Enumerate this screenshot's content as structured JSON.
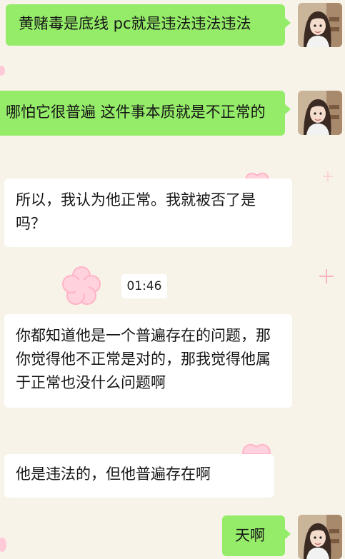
{
  "conversation": {
    "messages": [
      {
        "direction": "outgoing",
        "text": "黄赌毒是底线 pc就是违法违法违法"
      },
      {
        "direction": "outgoing",
        "text": "哪怕它很普遍 这件事本质就是不正常的"
      },
      {
        "direction": "incoming",
        "text": "所以，我认为他正常。我就被否了是吗？"
      },
      {
        "direction": "incoming",
        "text": "你都知道他是一个普遍存在的问题，那你觉得他不正常是对的，那我觉得他属于正常也没什么问题啊"
      },
      {
        "direction": "incoming",
        "text": "他是违法的，但他普遍存在啊"
      },
      {
        "direction": "outgoing",
        "text": "天啊"
      }
    ],
    "timestamp": "01:46"
  },
  "colors": {
    "background": "#f7f3e9",
    "outgoing_bubble": "#95ec69",
    "incoming_bubble": "#ffffff",
    "decoration_pink": "#ffc9d7"
  }
}
